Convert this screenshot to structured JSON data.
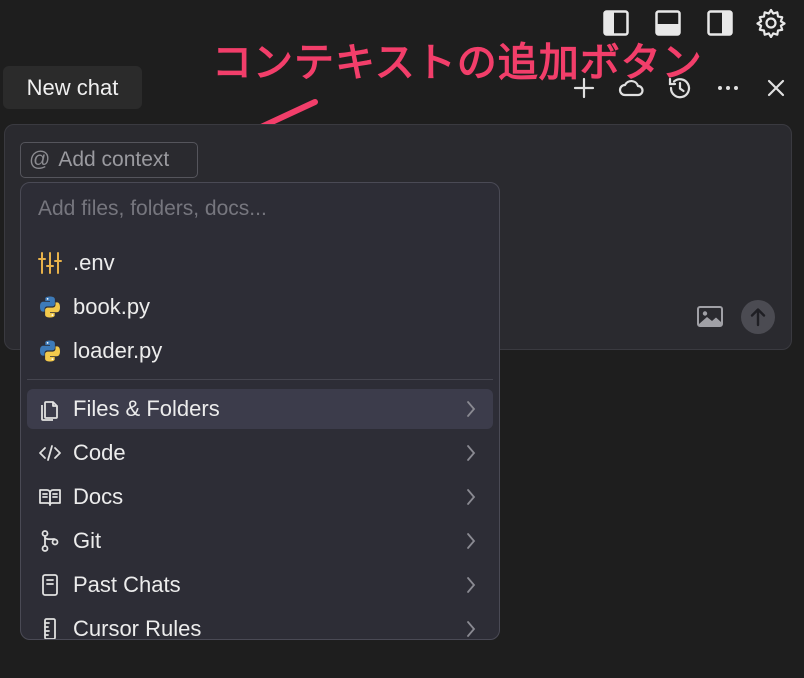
{
  "annotation": {
    "text": "コンテキストの追加ボタン",
    "color": "#f23e6a"
  },
  "tab": {
    "label": "New chat"
  },
  "composer": {
    "add_context_label": "Add context"
  },
  "dropdown": {
    "search_placeholder": "Add files, folders, docs...",
    "recent_files": [
      {
        "label": ".env",
        "icon": "sliders-icon"
      },
      {
        "label": "book.py",
        "icon": "python-icon"
      },
      {
        "label": "loader.py",
        "icon": "python-icon"
      }
    ],
    "categories": [
      {
        "label": "Files & Folders",
        "icon": "files-icon",
        "selected": true
      },
      {
        "label": "Code",
        "icon": "code-icon"
      },
      {
        "label": "Docs",
        "icon": "book-icon"
      },
      {
        "label": "Git",
        "icon": "git-branch-icon"
      },
      {
        "label": "Past Chats",
        "icon": "notebook-icon"
      },
      {
        "label": "Cursor Rules",
        "icon": "ruler-icon"
      }
    ]
  }
}
